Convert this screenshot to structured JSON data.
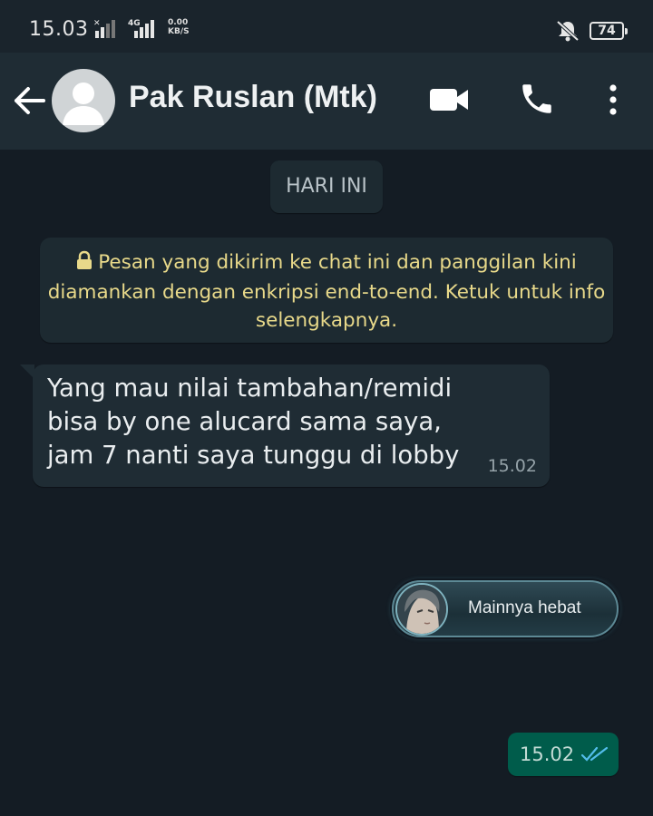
{
  "status_bar": {
    "time": "15.03",
    "network_label": "4G",
    "speed_value": "0.00",
    "speed_unit": "KB/S",
    "battery": "74",
    "icons": [
      "signal-icon",
      "signal-4g-icon",
      "mute-icon",
      "battery-icon"
    ]
  },
  "header": {
    "contact_name": "Pak Ruslan (Mtk)",
    "icons": [
      "back-arrow-icon",
      "avatar-icon",
      "video-call-icon",
      "voice-call-icon",
      "more-options-icon"
    ]
  },
  "chat": {
    "date_chip": "HARI INI",
    "encryption_notice": "Pesan yang dikirim ke chat ini dan panggilan kini diamankan dengan enkripsi end-to-end. Ketuk untuk info selengkapnya.",
    "messages": [
      {
        "direction": "incoming",
        "text": "Yang mau nilai tambahan/remidi bisa by one alucard sama saya, jam 7 nanti saya tunggu di lobby",
        "time": "15.02"
      },
      {
        "direction": "outgoing",
        "type": "sticker",
        "sticker_text": "Mainnya hebat"
      },
      {
        "direction": "outgoing",
        "time": "15.02",
        "status": "read"
      }
    ]
  },
  "colors": {
    "background": "#141c24",
    "header": "#1f2c34",
    "incoming_bubble": "#1f2c34",
    "outgoing_bubble": "#005c4b",
    "notice_text": "#e8d98a",
    "read_ticks": "#53bdeb"
  }
}
